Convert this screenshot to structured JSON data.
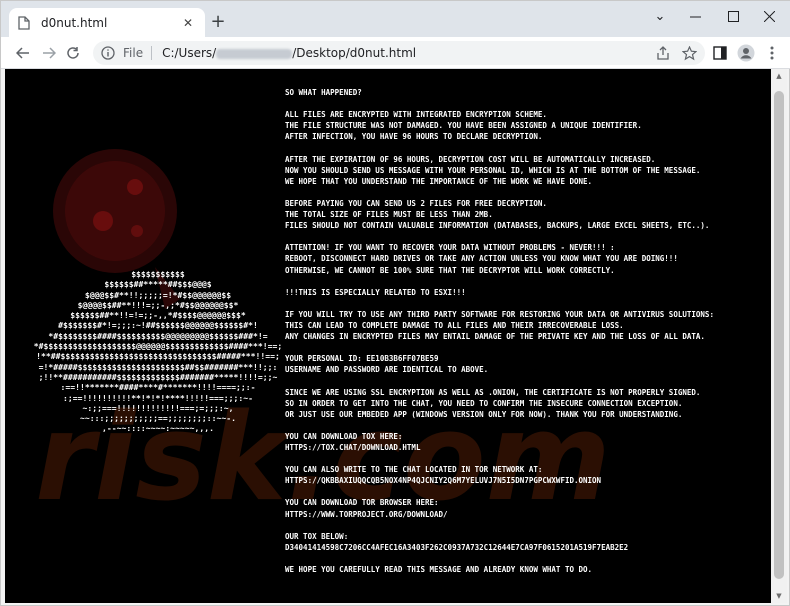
{
  "browser": {
    "tab_title": "d0nut.html",
    "new_tab": "+",
    "omnibox": {
      "scheme_label": "File",
      "url_prefix": "C:/Users/",
      "url_suffix": "/Desktop/d0nut.html"
    },
    "window_controls": {
      "minimize": "—",
      "maximize": "☐",
      "close": "✕"
    },
    "collapse": "⌄"
  },
  "icons": [
    "file-icon",
    "close-icon",
    "plus-icon",
    "back-icon",
    "forward-icon",
    "reload-icon",
    "info-icon",
    "share-icon",
    "star-icon",
    "sidebar-icon",
    "profile-icon",
    "menu-icon"
  ],
  "ascii_art": [
    "$$$$$$$$$$$",
    "$$$$$$##*****##$$$@@@$",
    "$@@@$$#**!!;;;;;=!*#$$@@@@@@$$",
    "$@@@@$$##**!!!=;;-,;*#$$@@@@@@$$*",
    "$$$$$$##**!!=!=;;-,,*#$$$$@@@@@@$$$*",
    "#$$$$$$$#*!=;;;:~!##$$$$$$@@@@@@$$$$$$#*!",
    "*#$$$$$$$$####$$$$$$$$$$@@@@@@@@@$$$$$$###*!=",
    "*#$$$$$$$$$$$$$$$$$$$@@@@@@$$$$$$$$$$$$$####***!==;",
    "!**##$$$$$$$$$$$$$$$$$$$$$$$$$$$$$$$$#####***!!==;",
    "=!*#####$$$$$$$$$$$$$$$$$$$$$$##$$#######***!!;;:",
    ";!!**###########$$$$$$$$$$$$$#######*****!!!!=;;~",
    ":==!!*******####****#*******!!!!====;;:-",
    ":;==!!!!!!!!!!**!*!*!****!!!!!===;;;:~-",
    "~:;;===!!!!!!!!!!!!!===;=;;;:~,",
    "~~:::;;;;;;;;;;;==;;;;;;;;::~~-.",
    ",--~~::::~~~~:~~~~~,,,."
  ],
  "note": {
    "paragraphs": [
      [
        "SO WHAT HAPPENED?"
      ],
      [
        "ALL FILES ARE ENCRYPTED WITH INTEGRATED ENCRYPTION SCHEME.",
        "THE FILE STRUCTURE WAS NOT DAMAGED. YOU HAVE BEEN ASSIGNED A UNIQUE IDENTIFIER.",
        "AFTER INFECTION, YOU HAVE 96 HOURS TO DECLARE DECRYPTION."
      ],
      [
        "AFTER THE EXPIRATION OF 96 HOURS, DECRYPTION COST WILL BE AUTOMATICALLY INCREASED.",
        "NOW YOU SHOULD SEND US MESSAGE WITH YOUR PERSONAL ID, WHICH IS AT THE BOTTOM OF THE MESSAGE.",
        "WE HOPE THAT YOU UNDERSTAND THE IMPORTANCE OF THE WORK WE HAVE DONE."
      ],
      [
        "BEFORE PAYING YOU CAN SEND US 2 FILES FOR FREE DECRYPTION.",
        "THE TOTAL SIZE OF FILES MUST BE LESS THAN 2MB.",
        "FILES SHOULD NOT CONTAIN VALUABLE INFORMATION (DATABASES, BACKUPS, LARGE EXCEL SHEETS, ETC..)."
      ],
      [
        "ATTENTION! IF YOU WANT TO RECOVER YOUR DATA WITHOUT PROBLEMS - NEVER!!! :",
        "REBOOT, DISCONNECT HARD DRIVES OR TAKE ANY ACTION UNLESS YOU KNOW WHAT YOU ARE DOING!!!",
        "OTHERWISE, WE CANNOT BE 100% SURE THAT THE DECRYPTOR WILL WORK CORRECTLY."
      ],
      [
        "!!!THIS IS ESPECIALLY RELATED TO ESXI!!!"
      ],
      [
        "IF YOU WILL TRY TO USE ANY THIRD PARTY SOFTWARE FOR RESTORING YOUR DATA OR ANTIVIRUS SOLUTIONS:",
        "THIS CAN LEAD TO COMPLETE DAMAGE TO ALL FILES AND THEIR IRRECOVERABLE LOSS.",
        "ANY CHANGES IN ENCRYPTED FILES MAY ENTAIL DAMAGE OF THE PRIVATE KEY AND THE LOSS OF ALL DATA."
      ],
      [
        "YOUR PERSONAL ID: EE10B3B6FF07BE59",
        "USERNAME AND PASSWORD ARE IDENTICAL TO ABOVE."
      ],
      [
        "SINCE WE ARE USING SSL ENCRYPTION AS WELL AS .ONION, THE CERTIFICATE IS NOT PROPERLY SIGNED.",
        "SO IN ORDER TO GET INTO THE CHAT, YOU NEED TO CONFIRM THE INSECURE CONNECTION EXCEPTION.",
        "OR JUST USE OUR EMBEDED APP (WINDOWS VERSION ONLY FOR NOW). THANK YOU FOR UNDERSTANDING."
      ],
      [
        "YOU CAN DOWNLOAD TOX HERE:",
        "HTTPS://TOX.CHAT/DOWNLOAD.HTML"
      ],
      [
        "YOU CAN ALSO WRITE TO THE CHAT LOCATED IN TOR NETWORK AT:",
        "HTTPS://QKBBAXIUQQCQB5NOX4NP4QJCNIY2Q6M7YELUVJ7N5I5DN7PGPCWXWFID.ONION"
      ],
      [
        "YOU CAN DOWNLOAD TOR BROWSER HERE:",
        "HTTPS://WWW.TORPROJECT.ORG/DOWNLOAD/"
      ],
      [
        "OUR TOX BELOW:",
        "D34041414598C7206CC4AFEC16A3403F262C0937A732C12644E7CA97F0615201A519F7EAB2E2"
      ],
      [
        "WE HOPE YOU CAREFULLY READ THIS MESSAGE AND ALREADY KNOW WHAT TO DO."
      ]
    ]
  },
  "colors": {
    "page_bg": "#000000",
    "text": "#ffffff",
    "watermark_red": "#7a1010",
    "watermark_orange": "#5a2a10"
  }
}
